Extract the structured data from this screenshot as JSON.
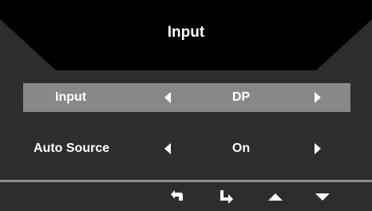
{
  "osd": {
    "title": "Input",
    "colors": {
      "background": "#2d2d2d",
      "header_fill": "#000000",
      "selected_row": "#888888",
      "divider": "#8a8a8a",
      "text": "#ffffff"
    },
    "rows": [
      {
        "label": "Input",
        "value": "DP",
        "selected": true
      },
      {
        "label": "Auto Source",
        "value": "On",
        "selected": false
      }
    ],
    "footer_icons": [
      "return-icon",
      "enter-icon",
      "up-arrow-icon",
      "down-arrow-icon"
    ]
  }
}
